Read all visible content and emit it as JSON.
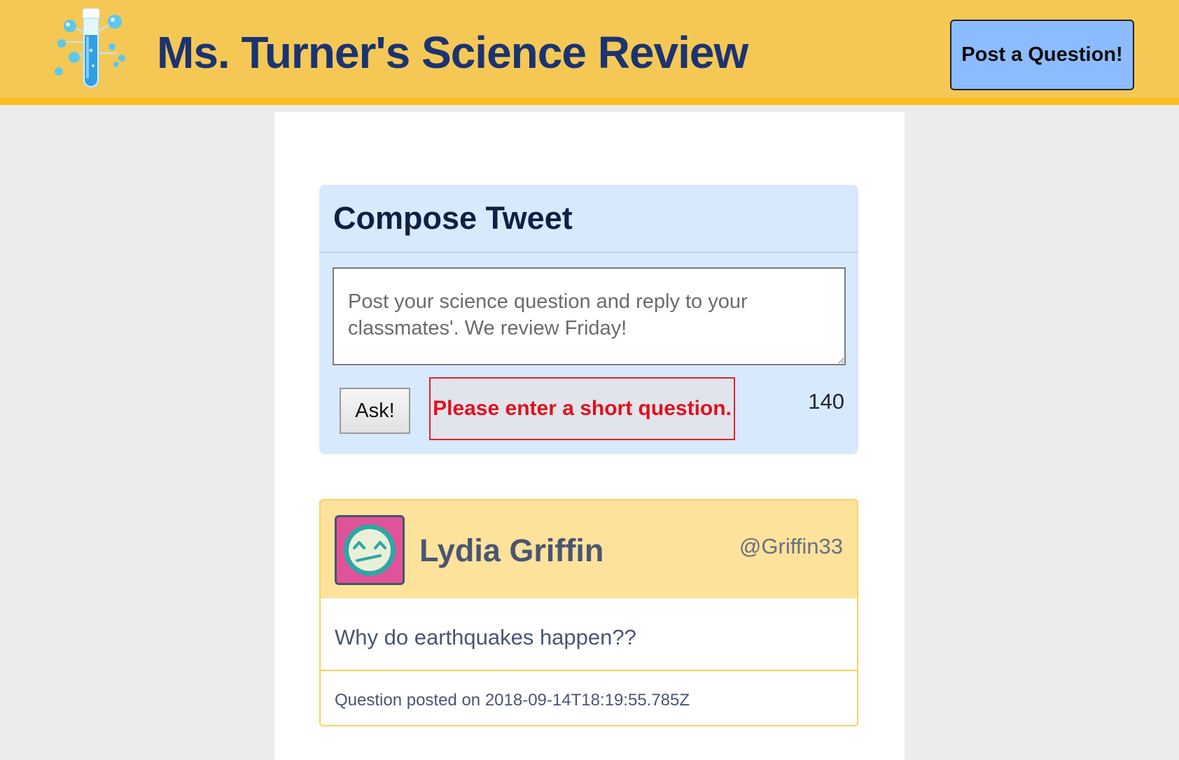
{
  "header": {
    "title": "Ms. Turner's Science Review",
    "post_button_label": "Post a Question!",
    "logo_icon": "test-tube-icon",
    "background_color": "#f5c855",
    "border_color": "#fcbd1e"
  },
  "compose": {
    "title": "Compose Tweet",
    "textarea_value": "",
    "textarea_placeholder": "Post your science question and reply to your classmates'. We review Friday!",
    "ask_button_label": "Ask!",
    "error_message": "Please enter a short question.",
    "char_counter": "140"
  },
  "tweets": [
    {
      "avatar_icon": "grimacing-face-icon",
      "name": "Lydia Griffin",
      "handle": "@Griffin33",
      "content": "Why do earthquakes happen??",
      "footer": "Question posted on 2018-09-14T18:19:55.785Z"
    }
  ]
}
